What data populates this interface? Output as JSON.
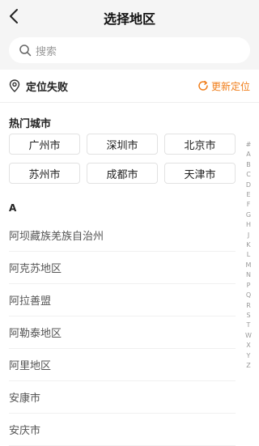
{
  "header": {
    "title": "选择地区",
    "back_icon": "chevron-left-icon"
  },
  "search": {
    "placeholder": "搜索",
    "icon": "search-icon"
  },
  "location": {
    "status": "定位失败",
    "refresh_label": "更新定位",
    "accent_color": "#f07d19"
  },
  "hot": {
    "title": "热门城市",
    "cities": [
      "广州市",
      "深圳市",
      "北京市",
      "苏州市",
      "成都市",
      "天津市"
    ]
  },
  "index": [
    "#",
    "A",
    "B",
    "C",
    "D",
    "E",
    "F",
    "G",
    "H",
    "J",
    "K",
    "L",
    "M",
    "N",
    "P",
    "Q",
    "R",
    "S",
    "T",
    "W",
    "X",
    "Y",
    "Z"
  ],
  "sections": [
    {
      "letter": "A",
      "items": [
        "阿坝藏族羌族自治州",
        "阿克苏地区",
        "阿拉善盟",
        "阿勒泰地区",
        "阿里地区",
        "安康市",
        "安庆市"
      ]
    }
  ]
}
